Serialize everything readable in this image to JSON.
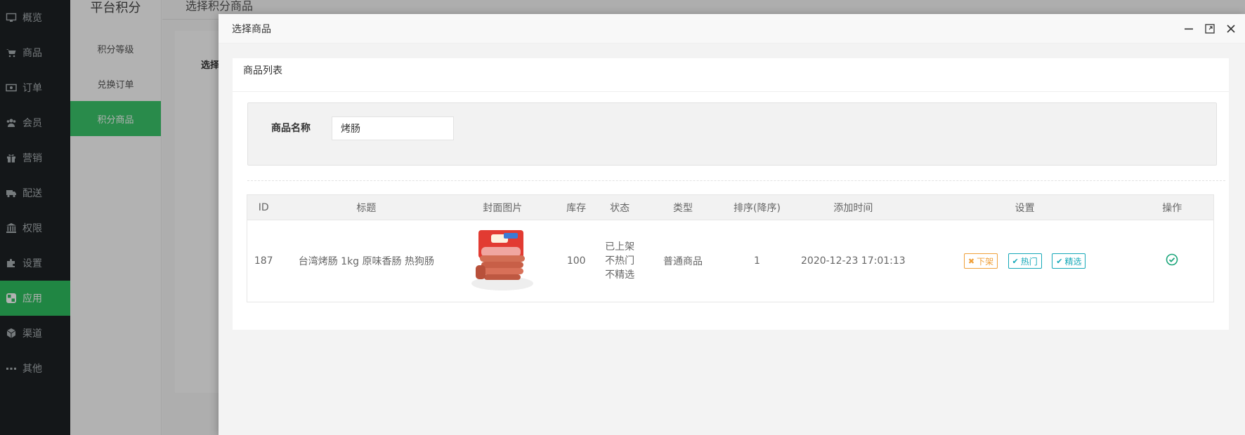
{
  "nav": {
    "items": [
      {
        "label": "概览",
        "icon": "monitor-icon"
      },
      {
        "label": "商品",
        "icon": "cart-icon"
      },
      {
        "label": "订单",
        "icon": "money-icon"
      },
      {
        "label": "会员",
        "icon": "users-icon"
      },
      {
        "label": "营销",
        "icon": "gift-icon"
      },
      {
        "label": "配送",
        "icon": "truck-icon"
      },
      {
        "label": "权限",
        "icon": "bank-icon"
      },
      {
        "label": "设置",
        "icon": "puzzle-icon"
      },
      {
        "label": "应用",
        "icon": "apps-icon"
      },
      {
        "label": "渠道",
        "icon": "cube-icon"
      },
      {
        "label": "其他",
        "icon": "dots-icon"
      }
    ],
    "active_color": "#2ec160"
  },
  "subnav": {
    "title": "平台积分",
    "items": [
      "积分等级",
      "兑换订单",
      "积分商品"
    ],
    "active_color": "#3bc76c"
  },
  "page": {
    "header": "选择积分商品",
    "label": "选择"
  },
  "modal": {
    "title": "选择商品",
    "card_title": "商品列表",
    "search": {
      "label": "商品名称",
      "value": "烤肠"
    },
    "table": {
      "headers": [
        "ID",
        "标题",
        "封面图片",
        "库存",
        "状态",
        "类型",
        "排序(降序)",
        "添加时间",
        "设置",
        "操作"
      ],
      "rows": [
        {
          "id": "187",
          "title": "台湾烤肠 1kg 原味香肠 热狗肠",
          "stock": "100",
          "status": [
            "已上架",
            "不热门",
            "不精选"
          ],
          "type": "普通商品",
          "sort": "1",
          "added": "2020-12-23 17:01:13",
          "settings": [
            {
              "label": "下架",
              "icon": "x-icon",
              "color": "#f0a03a"
            },
            {
              "label": "热门",
              "icon": "check-icon",
              "color": "#14a8b8"
            },
            {
              "label": "精选",
              "icon": "check-icon",
              "color": "#14a8b8"
            }
          ]
        }
      ]
    }
  }
}
